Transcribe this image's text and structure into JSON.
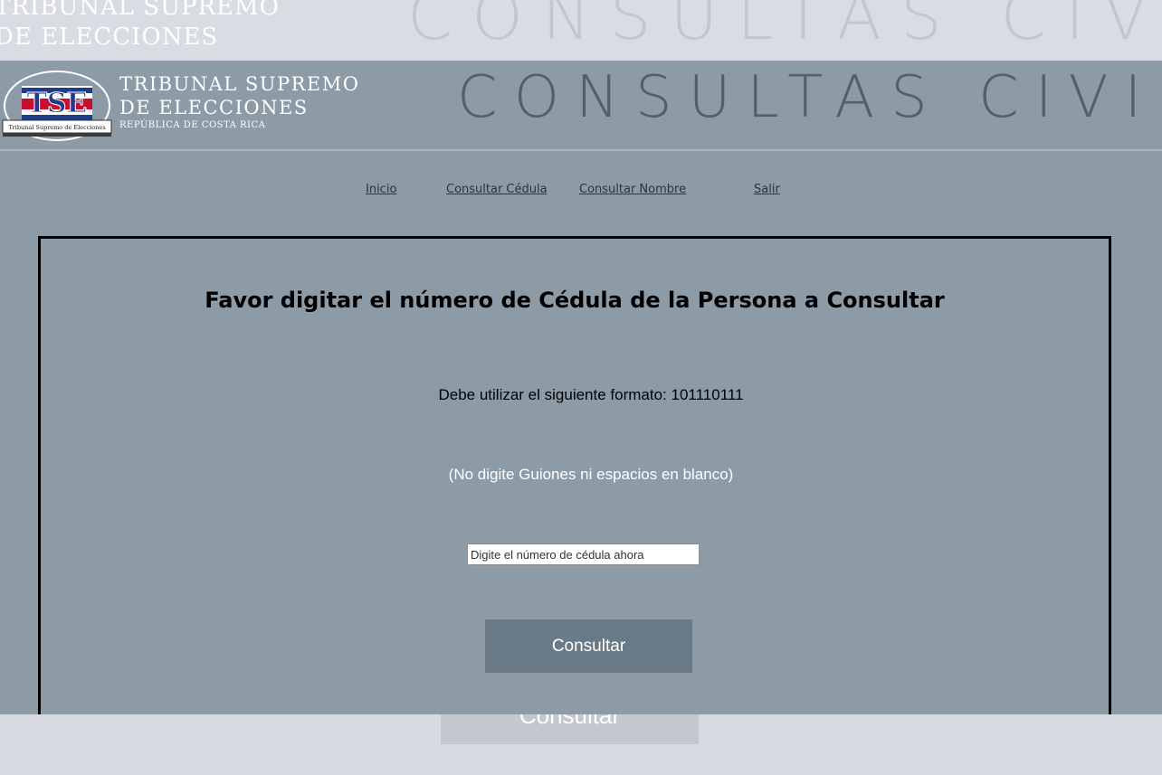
{
  "ghost_header": {
    "org_line1": "TRIBUNAL SUPREMO",
    "org_line2": "DE ELECCIONES",
    "title": "CONSULTAS CIVILES"
  },
  "header": {
    "logo_badge": "Tribunal Supremo de Elecciones",
    "org_line1": "TRIBUNAL SUPREMO",
    "org_line2": "DE ELECCIONES",
    "org_line3": "REPÚBLICA DE COSTA RICA",
    "title": "CONSULTAS CIVILES"
  },
  "nav": {
    "items": [
      {
        "label": "Inicio"
      },
      {
        "label": "Consultar Cédula"
      },
      {
        "label": "Consultar Nombre"
      },
      {
        "label": "Salir"
      }
    ]
  },
  "form": {
    "heading": "Favor digitar el número de Cédula de la Persona a Consultar",
    "format_text": "Debe utilizar el siguiente formato: 101110111",
    "hint_text": "(No digite Guiones ni espacios en blanco)",
    "input_placeholder": "Digite el número de cédula ahora",
    "input_value": "",
    "submit_label": "Consultar"
  },
  "ghost_button": {
    "label": "Consultar"
  },
  "colors": {
    "page_bg": "#8c9ba6",
    "title_color": "#4f606e",
    "button_bg": "#6a7a86",
    "logo_red": "#c8102e",
    "logo_blue": "#1f3c8a"
  }
}
